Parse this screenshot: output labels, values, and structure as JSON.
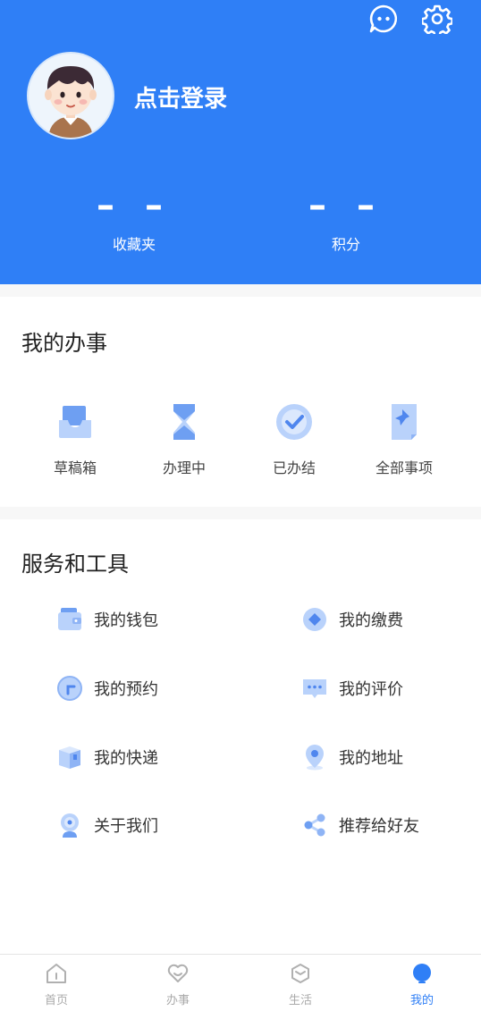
{
  "header": {
    "login_text": "点击登录",
    "stats": [
      {
        "value": "– –",
        "label": "收藏夹"
      },
      {
        "value": "– –",
        "label": "积分"
      }
    ],
    "icons": [
      "chat-bubble-icon",
      "settings-icon"
    ]
  },
  "my_affairs": {
    "title": "我的办事",
    "items": [
      {
        "label": "草稿箱",
        "icon": "draft-box-icon"
      },
      {
        "label": "办理中",
        "icon": "hourglass-icon"
      },
      {
        "label": "已办结",
        "icon": "check-circle-icon"
      },
      {
        "label": "全部事项",
        "icon": "all-items-icon"
      }
    ]
  },
  "services": {
    "title": "服务和工具",
    "items": [
      {
        "label": "我的钱包",
        "icon": "wallet-icon"
      },
      {
        "label": "我的缴费",
        "icon": "payment-icon"
      },
      {
        "label": "我的预约",
        "icon": "appointment-icon"
      },
      {
        "label": "我的评价",
        "icon": "comment-icon"
      },
      {
        "label": "我的快递",
        "icon": "package-icon"
      },
      {
        "label": "我的地址",
        "icon": "location-icon"
      },
      {
        "label": "关于我们",
        "icon": "about-icon"
      },
      {
        "label": "推荐给好友",
        "icon": "share-icon"
      }
    ]
  },
  "tabbar": {
    "items": [
      {
        "label": "首页",
        "icon": "home-icon"
      },
      {
        "label": "办事",
        "icon": "heart-icon"
      },
      {
        "label": "生活",
        "icon": "cube-icon"
      },
      {
        "label": "我的",
        "icon": "profile-icon"
      }
    ],
    "active_index": 3
  },
  "colors": {
    "primary": "#2f7ff6",
    "icon_light": "#b9d2fb",
    "icon_mid": "#6e9ff2"
  }
}
